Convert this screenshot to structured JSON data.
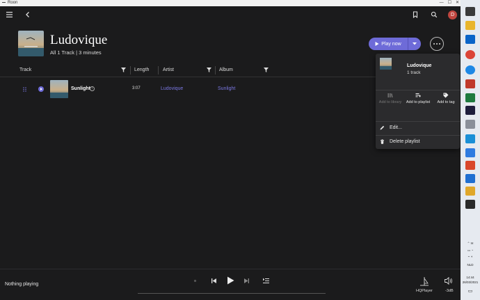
{
  "window": {
    "title": "Roon"
  },
  "album": {
    "title": "Ludovique",
    "subtitle": "All 1 Track | 3 minutes"
  },
  "actions": {
    "play_now": "Play now"
  },
  "table": {
    "headers": {
      "track": "Track",
      "length": "Length",
      "artist": "Artist",
      "album": "Album"
    },
    "rows": [
      {
        "title": "Sunlight",
        "length": "3:07",
        "artist": "Ludovique",
        "album": "Sunlight"
      }
    ]
  },
  "menu": {
    "title": "Ludovique",
    "subtitle": "1 track",
    "actions": [
      {
        "label": "Add to library",
        "disabled": true
      },
      {
        "label": "Add to playlist",
        "disabled": false
      },
      {
        "label": "Add to tag",
        "disabled": false
      }
    ],
    "items": [
      {
        "label": "Edit..."
      },
      {
        "label": "Delete playlist"
      }
    ]
  },
  "player": {
    "status": "Nothing playing",
    "zone": "HQPlayer",
    "volume": "-3dB"
  },
  "taskbar": {
    "language": "NLD",
    "time": "14:44",
    "date": "26/03/2021"
  },
  "colors": {
    "accent": "#6e6bd8",
    "link": "#7b78e3",
    "background": "#1b1b1c",
    "menu_bg": "#2b2b2d"
  }
}
